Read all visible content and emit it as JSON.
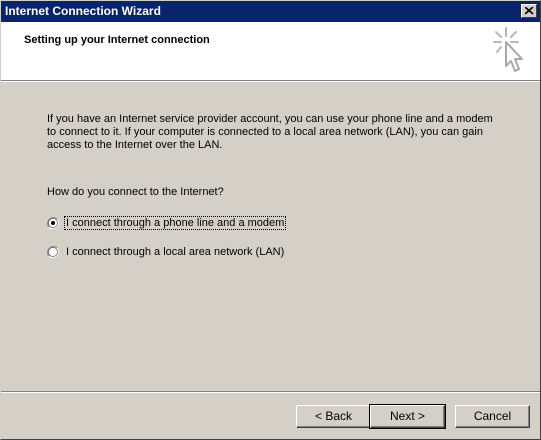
{
  "window": {
    "title": "Internet Connection Wizard"
  },
  "header": {
    "title": "Setting up your Internet connection"
  },
  "body": {
    "intro": "If you have an Internet service provider account, you can use your phone line and a modem to connect to it. If your computer is connected to a local area network (LAN), you can gain access to the Internet over the LAN.",
    "question": "How do you connect to the Internet?"
  },
  "options": [
    {
      "label": "I connect through a phone line and a modem",
      "selected": true,
      "mnemonic": "p"
    },
    {
      "label": "I connect through a local area network (LAN)",
      "selected": false,
      "mnemonic": "l"
    }
  ],
  "buttons": {
    "back": "Back",
    "next": "Next",
    "cancel": "Cancel"
  },
  "icons": {
    "close": "close-icon",
    "wizard": "wizard-cursor-icon"
  }
}
